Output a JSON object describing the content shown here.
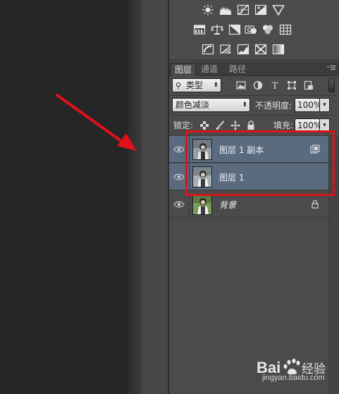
{
  "adjustments": {
    "rows": [
      [
        "brightness-contrast-icon",
        "levels-icon",
        "curves-icon",
        "exposure-icon",
        "vibrance-icon"
      ],
      [
        "hue-saturation-icon",
        "color-balance-icon",
        "black-white-icon",
        "photo-filter-icon",
        "channel-mixer-icon",
        "color-lookup-icon"
      ],
      [
        "invert-icon",
        "posterize-icon",
        "threshold-icon",
        "selective-color-icon",
        "gradient-map-icon"
      ]
    ]
  },
  "tabs": {
    "layers": "图层",
    "channels": "通道",
    "paths": "路径"
  },
  "filter": {
    "kind_label": "类型"
  },
  "blend": {
    "mode": "颜色减淡",
    "opacity_label": "不透明度:",
    "opacity_value": "100%"
  },
  "lock": {
    "label": "锁定:",
    "fill_label": "填充:",
    "fill_value": "100%"
  },
  "layers": [
    {
      "name": "图层 1 副本",
      "selected": true,
      "badge": "smart-object-icon"
    },
    {
      "name": "图层 1",
      "selected": true,
      "badge": ""
    },
    {
      "name": "背景",
      "selected": false,
      "badge": "lock-icon"
    }
  ],
  "watermark": {
    "brand": "Bai",
    "brand2": "经验",
    "url": "jingyan.baidu.com"
  },
  "colors": {
    "selection": "#5a6b80",
    "annotation": "#d8141c",
    "panel": "#4b4b4b"
  }
}
